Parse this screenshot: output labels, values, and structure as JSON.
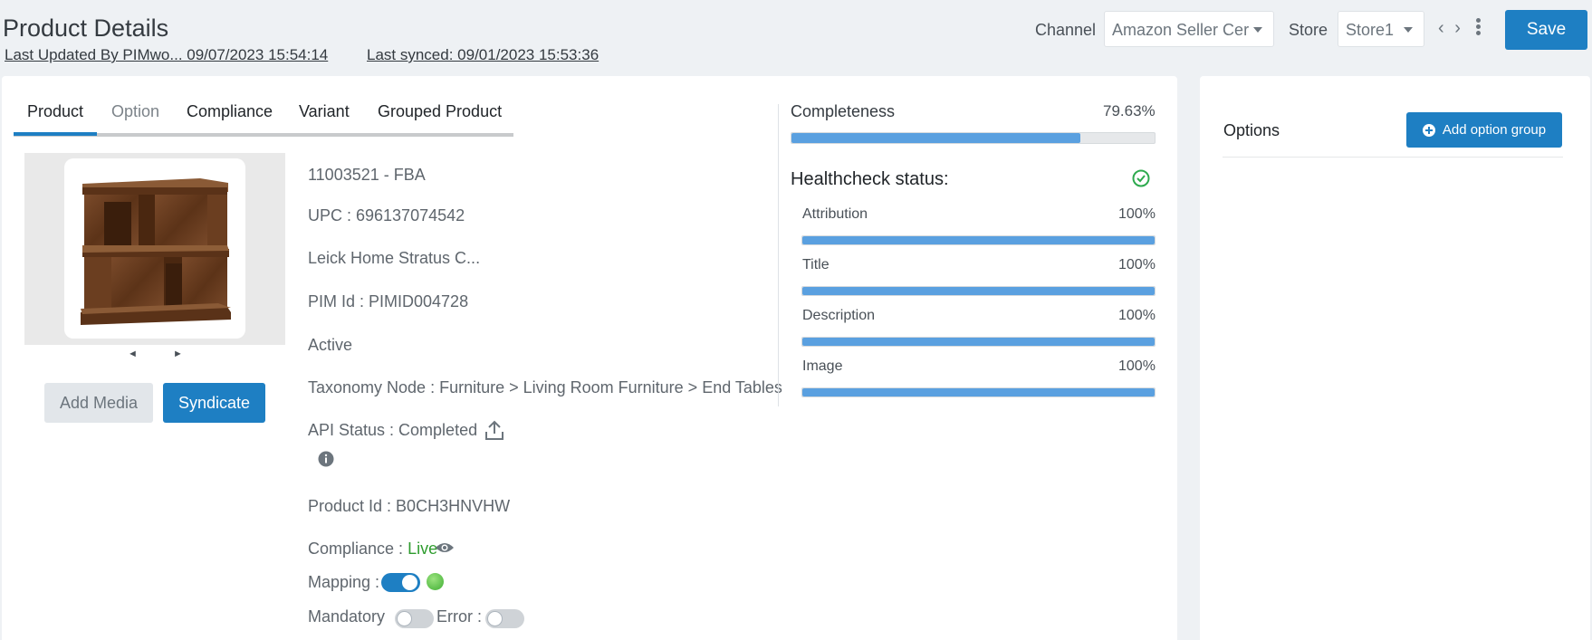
{
  "header": {
    "title": "Product Details",
    "last_updated_by": "Last Updated By  PIMwo...  09/07/2023 15:54:14",
    "last_synced": "Last synced: 09/01/2023 15:53:36",
    "channel_label": "Channel",
    "channel_value": "Amazon Seller Cer",
    "store_label": "Store",
    "store_value": "Store1",
    "nav_prev": "‹",
    "nav_next": "›",
    "save_label": "Save"
  },
  "tabs": [
    {
      "label": "Product",
      "active": true
    },
    {
      "label": "Option",
      "active": false
    },
    {
      "label": "Compliance",
      "active": false
    },
    {
      "label": "Variant",
      "active": false
    },
    {
      "label": "Grouped Product",
      "active": false
    }
  ],
  "media": {
    "prev": "◄",
    "next": "►",
    "add_media_label": "Add Media",
    "syndicate_label": "Syndicate"
  },
  "product": {
    "sku": "11003521 - FBA",
    "upc": "UPC  : 696137074542",
    "name": "Leick Home Stratus C...",
    "pim_id": "PIM Id : PIMID004728",
    "status": "Active",
    "taxonomy": "Taxonomy Node  : Furniture > Living Room Furniture > End Tables",
    "api_status": "API Status : Completed",
    "product_id": "Product Id : B0CH3HNVHW",
    "compliance_label": "Compliance : ",
    "compliance_value": "Live",
    "mapping_label": "Mapping :",
    "mapping_on": true,
    "mandatory_label": "Mandatory",
    "mandatory_on": false,
    "error_label": "Error :",
    "error_on": false
  },
  "completeness": {
    "label": "Completeness",
    "value_text": "79.63%",
    "value": 0.7963
  },
  "healthcheck": {
    "title": "Healthcheck status:",
    "items": [
      {
        "label": "Attribution",
        "value_text": "100%",
        "value": 1.0
      },
      {
        "label": "Title",
        "value_text": "100%",
        "value": 1.0
      },
      {
        "label": "Description",
        "value_text": "100%",
        "value": 1.0
      },
      {
        "label": "Image",
        "value_text": "100%",
        "value": 1.0
      }
    ]
  },
  "options_panel": {
    "title": "Options",
    "add_group_label": "Add option group"
  },
  "colors": {
    "accent": "#1e7fc3",
    "bar": "#5aa0e0",
    "live": "#2e9c2e",
    "health_ok": "#2eaa4e"
  }
}
